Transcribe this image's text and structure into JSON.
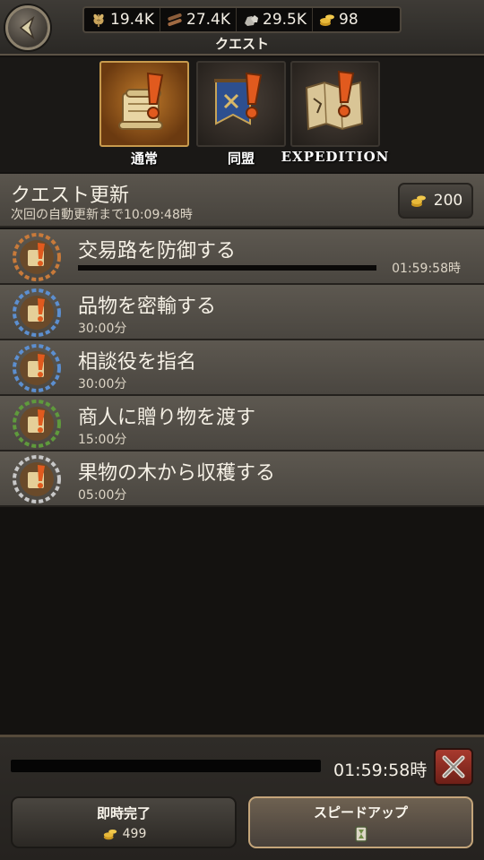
{
  "header": {
    "title": "クエスト",
    "resources": [
      {
        "icon": "wheat-icon",
        "value": "19.4K"
      },
      {
        "icon": "lumber-icon",
        "value": "27.4K"
      },
      {
        "icon": "stone-icon",
        "value": "29.5K"
      },
      {
        "icon": "gold-coins-icon",
        "value": "98"
      }
    ]
  },
  "tabs": [
    {
      "label": "通常",
      "active": true
    },
    {
      "label": "同盟",
      "active": false
    },
    {
      "label": "EXPEDITION",
      "active": false
    }
  ],
  "refresh": {
    "title": "クエスト更新",
    "subtitle": "次回の自動更新まで10:09:48時",
    "cost": "200"
  },
  "quests": [
    {
      "title": "交易路を防御する",
      "timer": "01:59:58時",
      "in_progress": true,
      "progress": 1.0,
      "rarity": "bronze"
    },
    {
      "title": "品物を密輸する",
      "time": "30:00分",
      "rarity": "blue"
    },
    {
      "title": "相談役を指名",
      "time": "30:00分",
      "rarity": "blue"
    },
    {
      "title": "商人に贈り物を渡す",
      "time": "15:00分",
      "rarity": "green"
    },
    {
      "title": "果物の木から収穫する",
      "time": "05:00分",
      "rarity": "silver"
    }
  ],
  "footer": {
    "timer": "01:59:58時",
    "progress": 1.0,
    "instant_label": "即時完了",
    "instant_cost": "499",
    "speedup_label": "スピードアップ"
  },
  "colors": {
    "accent": "#c79a4d",
    "cancel_red": "#a83a2e",
    "bronze": "#c87a3a",
    "blue": "#5c8fd0",
    "green": "#5f9a3c",
    "silver": "#c8c8c8"
  }
}
